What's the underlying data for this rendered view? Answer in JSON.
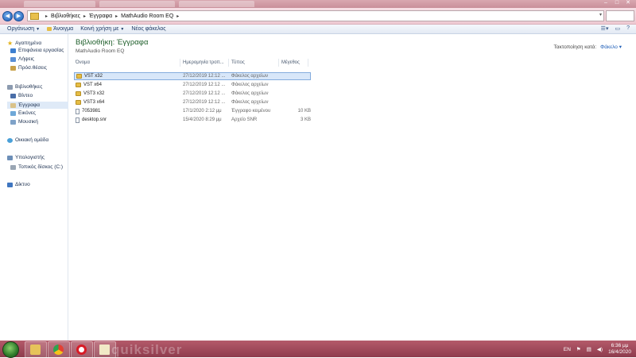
{
  "address_bar": {
    "crumbs": [
      "Βιβλιοθήκες",
      "Έγγραφα",
      "MathAudio Room EQ"
    ]
  },
  "toolbar": {
    "organize_label": "Οργάνωση",
    "open_label": "Άνοιγμα",
    "share_label": "Κοινή χρήση με",
    "new_folder_label": "Νέος φάκελος"
  },
  "nav": {
    "favorites_label": "Αγαπημένα",
    "favorites": [
      "Επιφάνεια εργασίας",
      "Λήψεις",
      "Πρόσ.θέσεις"
    ],
    "libraries_label": "Βιβλιοθήκες",
    "libraries": [
      "Βίντεο",
      "Έγγραφα",
      "Εικόνες",
      "Μουσική"
    ],
    "homegroup_label": "Οικιακή ομάδα",
    "computer_label": "Υπολογιστής",
    "computer_items": [
      "Τοπικός δίσκος (C:)"
    ],
    "network_label": "Δίκτυο"
  },
  "content": {
    "library_title": "Βιβλιοθήκη: Έγγραφα",
    "library_subtitle": "MathAudio Room EQ",
    "arrange_label": "Τακτοποίηση κατά:",
    "arrange_value": "Φάκελο",
    "columns": [
      "Όνομα",
      "Ημερομηνία τροπ...",
      "Τύπος",
      "Μέγεθος"
    ],
    "files": [
      {
        "name": "VST x32",
        "date": "27/12/2019 12:12 ...",
        "type": "Φάκελος αρχείων",
        "size": "",
        "kind": "folder"
      },
      {
        "name": "VST x64",
        "date": "27/12/2019 12:12 ...",
        "type": "Φάκελος αρχείων",
        "size": "",
        "kind": "folder"
      },
      {
        "name": "VST3 x32",
        "date": "27/12/2019 12:12 ...",
        "type": "Φάκελος αρχείων",
        "size": "",
        "kind": "folder"
      },
      {
        "name": "VST3 x64",
        "date": "27/12/2019 12:12 ...",
        "type": "Φάκελος αρχείων",
        "size": "",
        "kind": "folder"
      },
      {
        "name": "7053981",
        "date": "17/1/2020 2:12 μμ",
        "type": "Έγγραφο κειμένου",
        "size": "10 KB",
        "kind": "file"
      },
      {
        "name": "desktop.snr",
        "date": "15/4/2020 8:29 μμ",
        "type": "Αρχείο SNR",
        "size": "3 KB",
        "kind": "file"
      }
    ]
  },
  "taskbar": {
    "wallpaper_text": "quiksilver",
    "language": "EN",
    "time": "6:36 μμ",
    "date": "16/4/2020"
  },
  "colors": {
    "accent": "#1f5fb8",
    "title_green": "#1e5e2a",
    "taskbar": "#a04b5c"
  }
}
